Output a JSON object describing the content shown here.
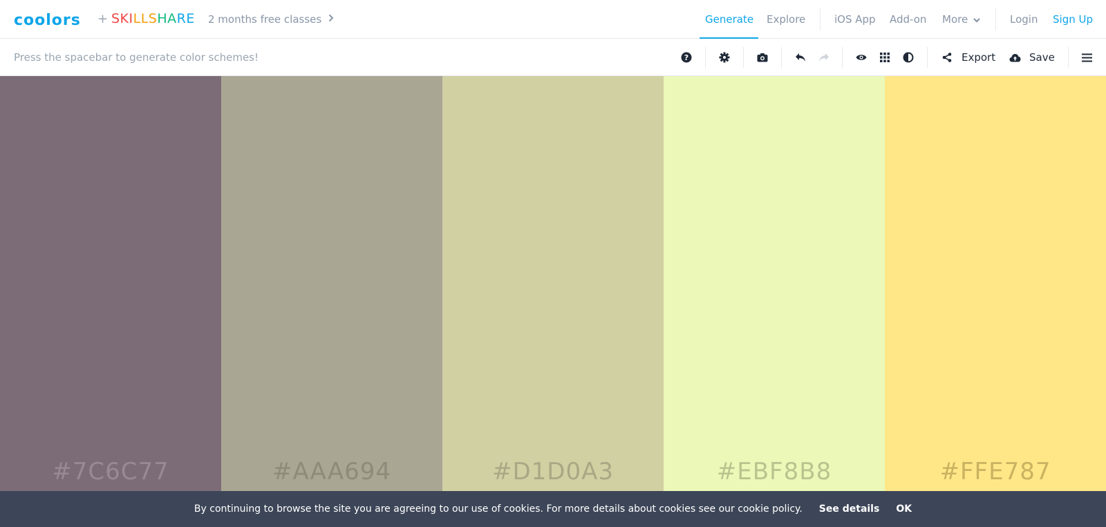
{
  "brand": {
    "logo": "coolors",
    "plus": "+",
    "partner": [
      "SKI",
      "LLS",
      "HA",
      "RE"
    ]
  },
  "promo": {
    "label": "2 months free classes",
    "chevron": "chevron-right-icon"
  },
  "nav": {
    "generate": "Generate",
    "explore": "Explore",
    "ios": "iOS App",
    "addon": "Add-on",
    "more": "More",
    "login": "Login",
    "signup": "Sign Up"
  },
  "toolbar": {
    "hint": "Press the spacebar to generate color schemes!",
    "export": "Export",
    "save": "Save"
  },
  "icons": {
    "help": "?",
    "settings": "⚙",
    "camera": "📷",
    "undo": "↶",
    "redo": "↷",
    "view": "◉",
    "grid": "▦",
    "contrast": "◐",
    "share": "⋖",
    "cloud": "☁",
    "menu": "☰",
    "more_chevron": "⌄"
  },
  "palette": [
    {
      "hex": "#7C6C77",
      "color": "#7c6c77",
      "text_color": "#988a94"
    },
    {
      "hex": "#AAA694",
      "color": "#aaa694",
      "text_color": "#8f8b7a"
    },
    {
      "hex": "#D1D0A3",
      "color": "#d1d0a3",
      "text_color": "#a9a884"
    },
    {
      "hex": "#EBF8B8",
      "color": "#ebf8b8",
      "text_color": "#b8c48e"
    },
    {
      "hex": "#FFE787",
      "color": "#ffe787",
      "text_color": "#c9b261"
    }
  ],
  "cookie": {
    "message": "By continuing to browse the site you are agreeing to our use of cookies. For more details about cookies see our cookie policy.",
    "details": "See details",
    "ok": "OK"
  },
  "colors": {
    "accent": "#0ea5e9",
    "cookie_bg": "#3d4658"
  }
}
